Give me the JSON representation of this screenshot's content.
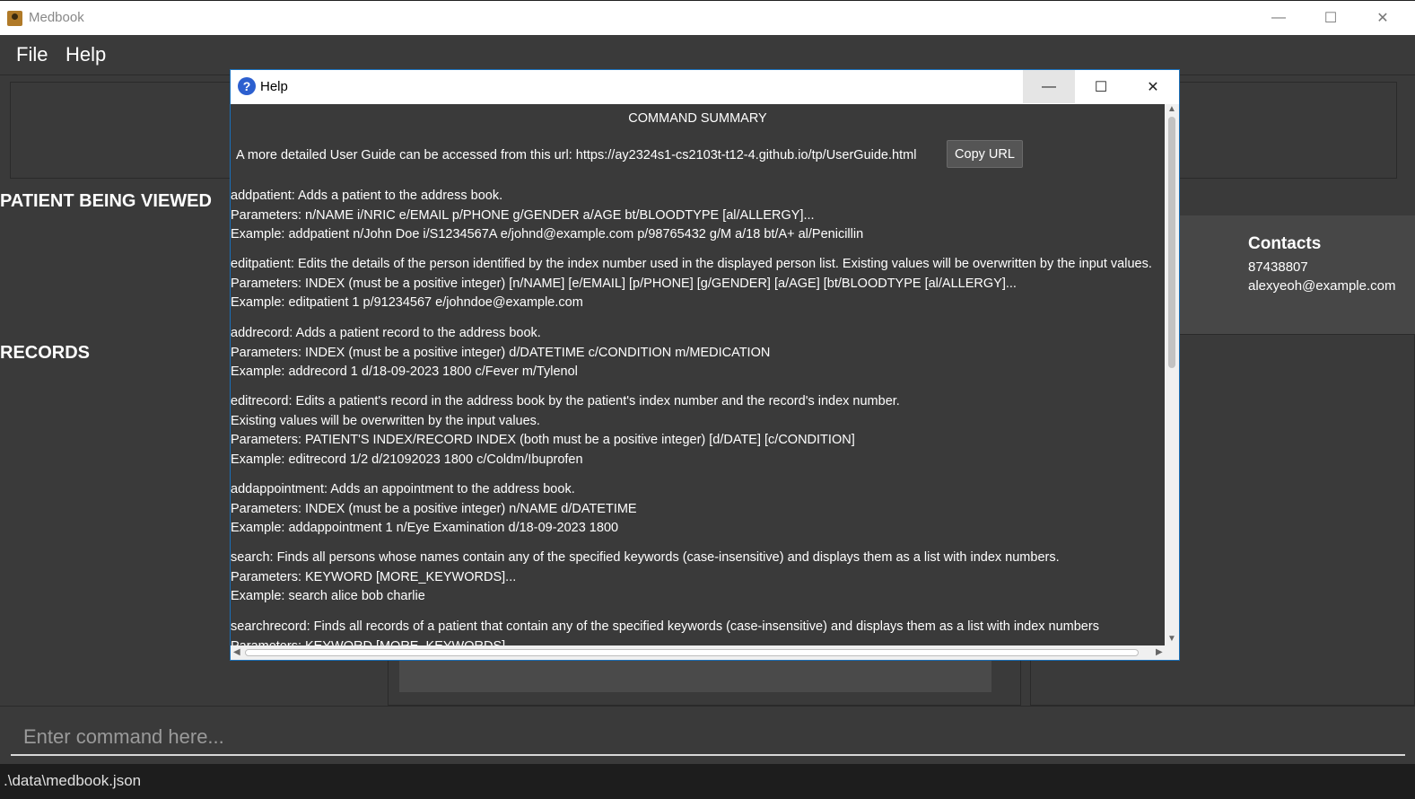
{
  "window": {
    "title": "Medbook",
    "minimize": "—",
    "maximize": "☐",
    "close": "✕"
  },
  "menu": {
    "file": "File",
    "help": "Help"
  },
  "sections": {
    "patient_being_viewed": "PATIENT BEING VIEWED",
    "records": "RECORDS"
  },
  "contact_card": {
    "heading": "Contacts",
    "phone": "87438807",
    "email": "alexyeoh@example.com"
  },
  "command_box": {
    "placeholder": "Enter command here..."
  },
  "status_bar": {
    "path": ".\\data\\medbook.json"
  },
  "help_dialog": {
    "title": "Help",
    "heading": "COMMAND SUMMARY",
    "url_text": "A more detailed User Guide can be accessed from this url: https://ay2324s1-cs2103t-t12-4.github.io/tp/UserGuide.html",
    "copy_url_label": "Copy URL",
    "commands": [
      {
        "lines": [
          "addpatient: Adds a patient to the address book.",
          "Parameters: n/NAME i/NRIC e/EMAIL p/PHONE g/GENDER a/AGE bt/BLOODTYPE [al/ALLERGY]...",
          "Example: addpatient n/John Doe i/S1234567A e/johnd@example.com p/98765432 g/M a/18 bt/A+ al/Penicillin"
        ]
      },
      {
        "lines": [
          "editpatient: Edits the details of the person identified by the index number used in the displayed person list. Existing values will be overwritten by the input values.",
          "Parameters: INDEX (must be a positive integer) [n/NAME] [e/EMAIL] [p/PHONE] [g/GENDER] [a/AGE] [bt/BLOODTYPE [al/ALLERGY]...",
          "Example: editpatient 1 p/91234567 e/johndoe@example.com"
        ]
      },
      {
        "lines": [
          "addrecord: Adds a patient record to the address book.",
          "Parameters: INDEX (must be a positive integer) d/DATETIME c/CONDITION m/MEDICATION",
          "Example: addrecord 1 d/18-09-2023 1800 c/Fever m/Tylenol"
        ]
      },
      {
        "lines": [
          "editrecord: Edits a patient's record in the address book by the patient's index number and the record's index number.",
          "Existing values will be overwritten by the input values.",
          "Parameters: PATIENT'S INDEX/RECORD INDEX (both must be a positive integer) [d/DATE] [c/CONDITION]",
          "Example: editrecord 1/2 d/21092023 1800 c/Coldm/Ibuprofen"
        ]
      },
      {
        "lines": [
          "addappointment: Adds an appointment to the address book.",
          "Parameters: INDEX (must be a positive integer) n/NAME d/DATETIME",
          "Example: addappointment 1 n/Eye Examination d/18-09-2023 1800"
        ]
      },
      {
        "lines": [
          "search: Finds all persons whose names contain any of the specified keywords (case-insensitive) and displays them as a list with index numbers.",
          "Parameters: KEYWORD [MORE_KEYWORDS]...",
          "Example: search alice bob charlie"
        ]
      },
      {
        "lines": [
          "searchrecord: Finds all records of a patient that contain any of the specified keywords (case-insensitive) and displays them as a list with index numbers",
          "Parameters: KEYWORD [MORE_KEYWORDS]..."
        ]
      }
    ]
  },
  "colors": {
    "background": "#3a3a3a",
    "titlebar": "#ffffff",
    "status_bar": "#1d1d1d",
    "accent_blue": "#2c5fcf"
  }
}
